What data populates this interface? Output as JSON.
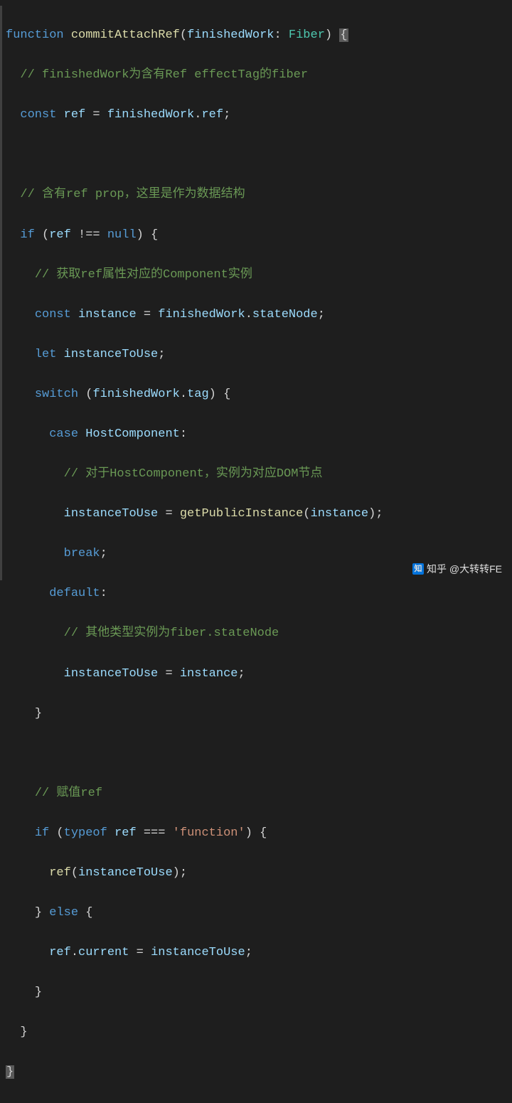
{
  "code": {
    "l1": {
      "kw_function": "function",
      "fn": "commitAttachRef",
      "param": "finishedWork",
      "type": "Fiber",
      "brace": "{"
    },
    "l2": {
      "comment": "// finishedWork为含有Ref effectTag的fiber"
    },
    "l3": {
      "kw_const": "const",
      "var_ref": "ref",
      "eq": " = ",
      "var_fw": "finishedWork",
      "dot": ".",
      "prop": "ref",
      "semi": ";"
    },
    "l5": {
      "comment": "// 含有ref prop，这里是作为数据结构"
    },
    "l6": {
      "kw_if": "if",
      "open": " (",
      "var_ref": "ref",
      "op": " !== ",
      "kw_null": "null",
      "close": ") {"
    },
    "l7": {
      "comment": "// 获取ref属性对应的Component实例"
    },
    "l8": {
      "kw_const": "const",
      "var_inst": "instance",
      "eq": " = ",
      "var_fw": "finishedWork",
      "dot": ".",
      "prop": "stateNode",
      "semi": ";"
    },
    "l9": {
      "kw_let": "let",
      "var": "instanceToUse",
      "semi": ";"
    },
    "l10": {
      "kw_switch": "switch",
      "open": " (",
      "var_fw": "finishedWork",
      "dot": ".",
      "prop": "tag",
      "close": ") {"
    },
    "l11": {
      "kw_case": "case",
      "var_hc": "HostComponent",
      "colon": ":"
    },
    "l12": {
      "comment": "// 对于HostComponent，实例为对应DOM节点"
    },
    "l13": {
      "var_itu": "instanceToUse",
      "eq": " = ",
      "fn": "getPublicInstance",
      "open": "(",
      "var_inst": "instance",
      "close": ");"
    },
    "l14": {
      "kw_break": "break",
      "semi": ";"
    },
    "l15": {
      "kw_default": "default",
      "colon": ":"
    },
    "l16": {
      "comment": "// 其他类型实例为fiber.stateNode"
    },
    "l17": {
      "var_itu": "instanceToUse",
      "eq": " = ",
      "var_inst": "instance",
      "semi": ";"
    },
    "l18": {
      "brace": "}"
    },
    "l20": {
      "comment": "// 赋值ref"
    },
    "l21": {
      "kw_if": "if",
      "open": " (",
      "kw_typeof": "typeof",
      "var_ref": " ref",
      "op": " === ",
      "str": "'function'",
      "close": ") {"
    },
    "l22": {
      "fn": "ref",
      "open": "(",
      "var_itu": "instanceToUse",
      "close": ");"
    },
    "l23": {
      "brace_close": "}",
      "kw_else": " else ",
      "brace_open": "{"
    },
    "l24": {
      "var_ref": "ref",
      "dot": ".",
      "prop": "current",
      "eq": " = ",
      "var_itu": "instanceToUse",
      "semi": ";"
    },
    "l25": {
      "brace": "}"
    },
    "l26": {
      "brace": "}"
    },
    "l27": {
      "brace": "}"
    }
  },
  "watermark": {
    "logo_text": "知",
    "text": "知乎 @大转转FE"
  }
}
